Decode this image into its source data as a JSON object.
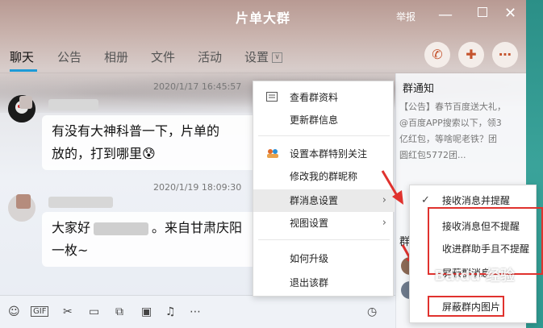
{
  "window": {
    "title": "片单大群",
    "report_label": "举报"
  },
  "tabs": [
    {
      "label": "聊天",
      "active": true
    },
    {
      "label": "公告"
    },
    {
      "label": "相册"
    },
    {
      "label": "文件"
    },
    {
      "label": "活动"
    },
    {
      "label": "设置"
    }
  ],
  "messages": [
    {
      "time": "2020/1/17 16:45:57",
      "text_line1": "有没有大神科普一下，片单的",
      "text_line2": "放的，打到哪里😰"
    },
    {
      "time": "2020/1/19 18:09:30",
      "text_prefix": "大家好",
      "text_suffix": "。来自甘肃庆阳",
      "text_line2": "一枚~"
    }
  ],
  "side_panel": {
    "title": "群通知",
    "lines": [
      "【公告】春节百度送大礼，",
      "@百度APP搜索以下，领3",
      "亿红包，等啥呢老铁？团",
      "圆红包5772团..."
    ],
    "partial_label": "群"
  },
  "context_menu": {
    "items": [
      {
        "label": "查看群资料",
        "icon": "card-icon"
      },
      {
        "label": "更新群信息"
      },
      {
        "label": "设置本群特别关注",
        "icon": "users-icon"
      },
      {
        "label": "修改我的群昵称"
      },
      {
        "label": "群消息设置",
        "submenu": true,
        "hover": true
      },
      {
        "label": "视图设置",
        "submenu": true
      },
      {
        "label": "如何升级"
      },
      {
        "label": "退出该群"
      }
    ]
  },
  "submenu": {
    "items": [
      {
        "label": "接收消息并提醒",
        "checked": true
      },
      {
        "label": "接收消息但不提醒"
      },
      {
        "label": "收进群助手且不提醒"
      },
      {
        "label": "屏蔽群消息"
      },
      {
        "label": "屏蔽群内图片"
      }
    ]
  },
  "watermark": "Baidu 经验",
  "colors": {
    "highlight": "#e0322e",
    "accent": "#1e9bd7",
    "title_text": "#ffffff"
  }
}
